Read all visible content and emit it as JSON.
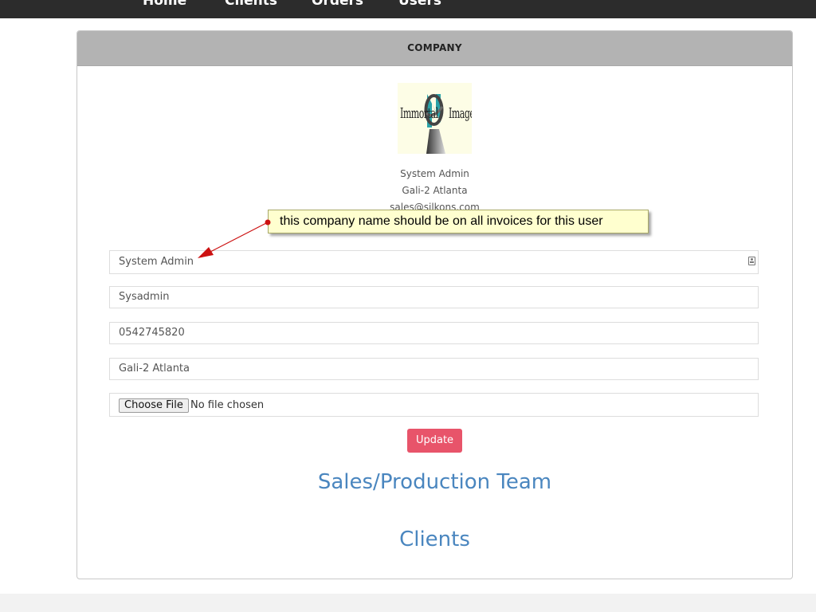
{
  "nav": {
    "items": [
      "Home",
      "Clients",
      "Orders",
      "Users"
    ]
  },
  "panel": {
    "heading": "COMPANY"
  },
  "logo": {
    "left_text": "Immortal",
    "right_text": "Image"
  },
  "company_info": {
    "name": "System Admin",
    "address": "Gali-2 Atlanta",
    "email": "sales@silkons.com"
  },
  "form": {
    "company_name_value": "System Admin",
    "username_value": "Sysadmin",
    "phone_value": "0542745820",
    "address_value": "Gali-2 Atlanta",
    "choose_file_label": "Choose File",
    "no_file_label": "No file chosen",
    "update_label": "Update"
  },
  "sections": {
    "team_title": "Sales/Production Team",
    "clients_title": "Clients"
  },
  "annotation": {
    "callout_text": "this company name should be on all invoices for this user"
  },
  "colors": {
    "nav_bg": "#2c2c2c",
    "panel_heading_bg": "#b3b3b3",
    "update_button": "#e8546a",
    "section_title": "#4a86bf",
    "callout_bg": "#ffffcf",
    "arrow": "#cc1111"
  }
}
